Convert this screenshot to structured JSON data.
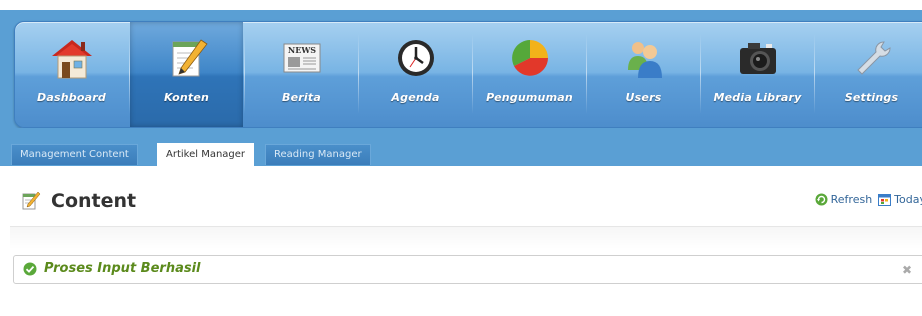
{
  "nav": {
    "items": [
      {
        "label": "Dashboard",
        "icon": "home-icon"
      },
      {
        "label": "Konten",
        "icon": "notepad-icon"
      },
      {
        "label": "Berita",
        "icon": "newspaper-icon"
      },
      {
        "label": "Agenda",
        "icon": "clock-icon"
      },
      {
        "label": "Pengumuman",
        "icon": "pie-chart-icon"
      },
      {
        "label": "Users",
        "icon": "users-icon"
      },
      {
        "label": "Media Library",
        "icon": "camera-icon"
      },
      {
        "label": "Settings",
        "icon": "wrench-icon"
      }
    ],
    "active": "Konten",
    "newspaper_text": "NEWS"
  },
  "subtabs": [
    {
      "label": "Management Content"
    },
    {
      "label": "Artikel Manager"
    },
    {
      "label": "Reading Manager"
    }
  ],
  "active_subtab": "Artikel Manager",
  "page": {
    "title": "Content",
    "refresh_label": "Refresh",
    "today_label": "Today"
  },
  "message": {
    "text": "Proses Input Berhasil",
    "close_glyph": "✖"
  },
  "colors": {
    "nav_blue": "#5a9fd4",
    "success_green": "#5b8a1c"
  }
}
